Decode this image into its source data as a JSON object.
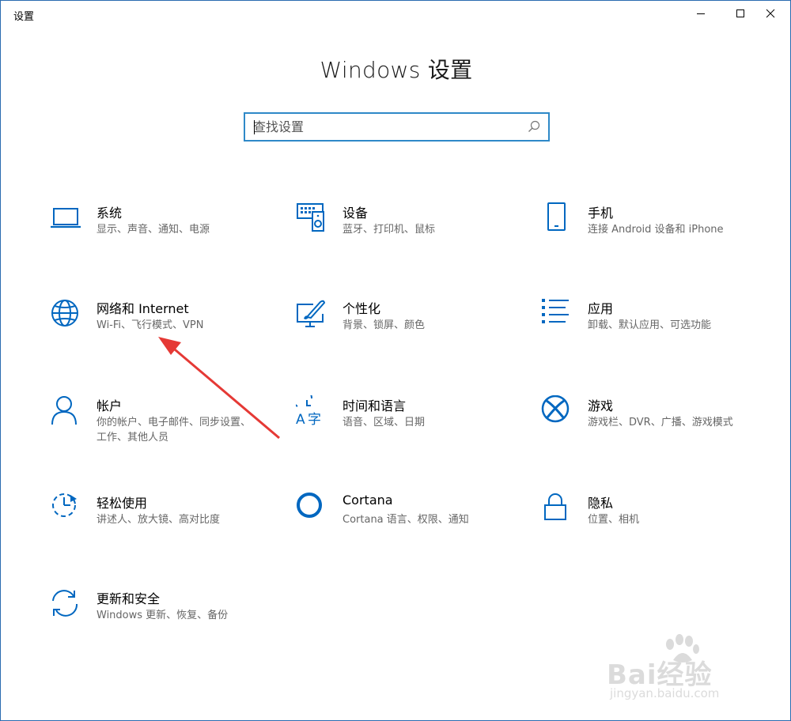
{
  "window": {
    "title": "设置",
    "controls": {
      "minimize": "minimize-icon",
      "maximize": "maximize-icon",
      "close": "close-icon"
    }
  },
  "heading": "Windows 设置",
  "search": {
    "placeholder": "查找设置",
    "icon": "search-icon"
  },
  "accent_color": "#0067c0",
  "tiles": [
    {
      "title": "系统",
      "subtitle": "显示、声音、通知、电源",
      "icon": "laptop-icon"
    },
    {
      "title": "设备",
      "subtitle": "蓝牙、打印机、鼠标",
      "icon": "devices-icon"
    },
    {
      "title": "手机",
      "subtitle": "连接 Android 设备和 iPhone",
      "icon": "phone-icon"
    },
    {
      "title": "网络和 Internet",
      "subtitle": "Wi-Fi、飞行模式、VPN",
      "icon": "globe-icon"
    },
    {
      "title": "个性化",
      "subtitle": "背景、锁屏、颜色",
      "icon": "personalization-icon"
    },
    {
      "title": "应用",
      "subtitle": "卸载、默认应用、可选功能",
      "icon": "apps-list-icon"
    },
    {
      "title": "帐户",
      "subtitle": "你的帐户、电子邮件、同步设置、工作、其他人员",
      "icon": "person-icon"
    },
    {
      "title": "时间和语言",
      "subtitle": "语音、区域、日期",
      "icon": "time-language-icon"
    },
    {
      "title": "游戏",
      "subtitle": "游戏栏、DVR、广播、游戏模式",
      "icon": "xbox-icon"
    },
    {
      "title": "轻松使用",
      "subtitle": "讲述人、放大镜、高对比度",
      "icon": "ease-of-access-icon"
    },
    {
      "title": "Cortana",
      "subtitle": "Cortana 语言、权限、通知",
      "icon": "cortana-icon"
    },
    {
      "title": "隐私",
      "subtitle": "位置、相机",
      "icon": "lock-icon"
    },
    {
      "title": "更新和安全",
      "subtitle": "Windows 更新、恢复、备份",
      "icon": "update-icon"
    }
  ],
  "annotation": {
    "color": "#e53935",
    "icon": "red-arrow-annotation"
  },
  "watermark": {
    "brand": "Bai经验",
    "url": "jingyan.baidu.com"
  }
}
